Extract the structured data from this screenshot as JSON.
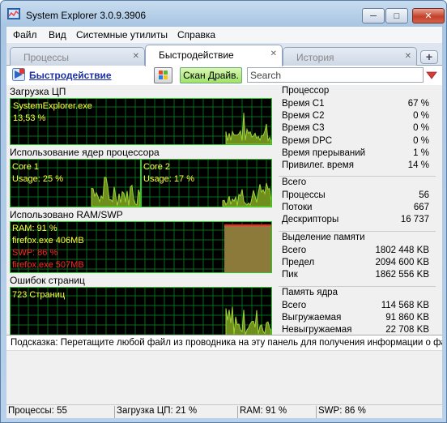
{
  "window": {
    "title": "System Explorer 3.0.9.3906",
    "minimize": "─",
    "maximize": "□",
    "close": "✕"
  },
  "menu": [
    "Файл",
    "Вид",
    "Системные утилиты",
    "Справка"
  ],
  "tabs": [
    {
      "label": "Процессы",
      "active": false
    },
    {
      "label": "Быстродействие",
      "active": true
    },
    {
      "label": "История",
      "active": false
    }
  ],
  "tab_new_label": "+",
  "toolbar": {
    "title": "Быстродействие",
    "scan_button": "Скан Драйв.",
    "search_placeholder": "Search"
  },
  "graphs": {
    "cpu": {
      "label": "Загрузка ЦП",
      "process": "SystemExplorer.exe",
      "value": "13,53 %"
    },
    "cores": {
      "label": "Использование ядер процессора",
      "core1": {
        "name": "Core 1",
        "usage": "Usage: 25 %"
      },
      "core2": {
        "name": "Core 2",
        "usage": "Usage: 17 %"
      }
    },
    "ram": {
      "label": "Использовано RAM/SWP",
      "ram": "RAM: 91 %",
      "ram_process": "firefox.exe 406MB",
      "swp": "SWP: 86 %",
      "swp_process": "firefox.exe 507MB"
    },
    "pagefaults": {
      "label": "Ошибок страниц",
      "value": "723 Страниц"
    }
  },
  "stats": {
    "cpu": {
      "title": "Процессор",
      "rows": [
        {
          "k": "Время C1",
          "v": "67 %"
        },
        {
          "k": "Время C2",
          "v": "0 %"
        },
        {
          "k": "Время C3",
          "v": "0 %"
        },
        {
          "k": "Время DPC",
          "v": "0 %"
        },
        {
          "k": "Время прерываний",
          "v": "1 %"
        },
        {
          "k": "Привилег. время",
          "v": "14 %"
        }
      ]
    },
    "total": {
      "title": "Всего",
      "rows": [
        {
          "k": "Процессы",
          "v": "56"
        },
        {
          "k": "Потоки",
          "v": "667"
        },
        {
          "k": "Дескрипторы",
          "v": "16 737"
        }
      ]
    },
    "memory": {
      "title": "Выделение памяти",
      "rows": [
        {
          "k": "Всего",
          "v": "1802 448 KB"
        },
        {
          "k": "Предел",
          "v": "2094 600 KB"
        },
        {
          "k": "Пик",
          "v": "1862 556 KB"
        }
      ]
    },
    "kernel": {
      "title": "Память ядра",
      "rows": [
        {
          "k": "Всего",
          "v": "114 568 KB"
        },
        {
          "k": "Выгружаемая",
          "v": "91 860 KB"
        },
        {
          "k": "Невыгружаемая",
          "v": "22 708 KB"
        }
      ]
    }
  },
  "hint": "Подсказка: Перетащите любой файл из проводника на эту панель для получения информации о файле",
  "status": {
    "processes": "Процессы: 55",
    "cpu": "Загрузка ЦП: 21 %",
    "ram": "RAM: 91 %",
    "swp": "SWP: 86 %"
  },
  "colors": {
    "graph_bg": "#000000",
    "grid": "#0a6a1a",
    "line": "#9fd23a",
    "fill": "#6f8f1d",
    "text_yellow": "#ffff3a",
    "text_red": "#ff2424",
    "ram_block": "#8c7a3a"
  }
}
